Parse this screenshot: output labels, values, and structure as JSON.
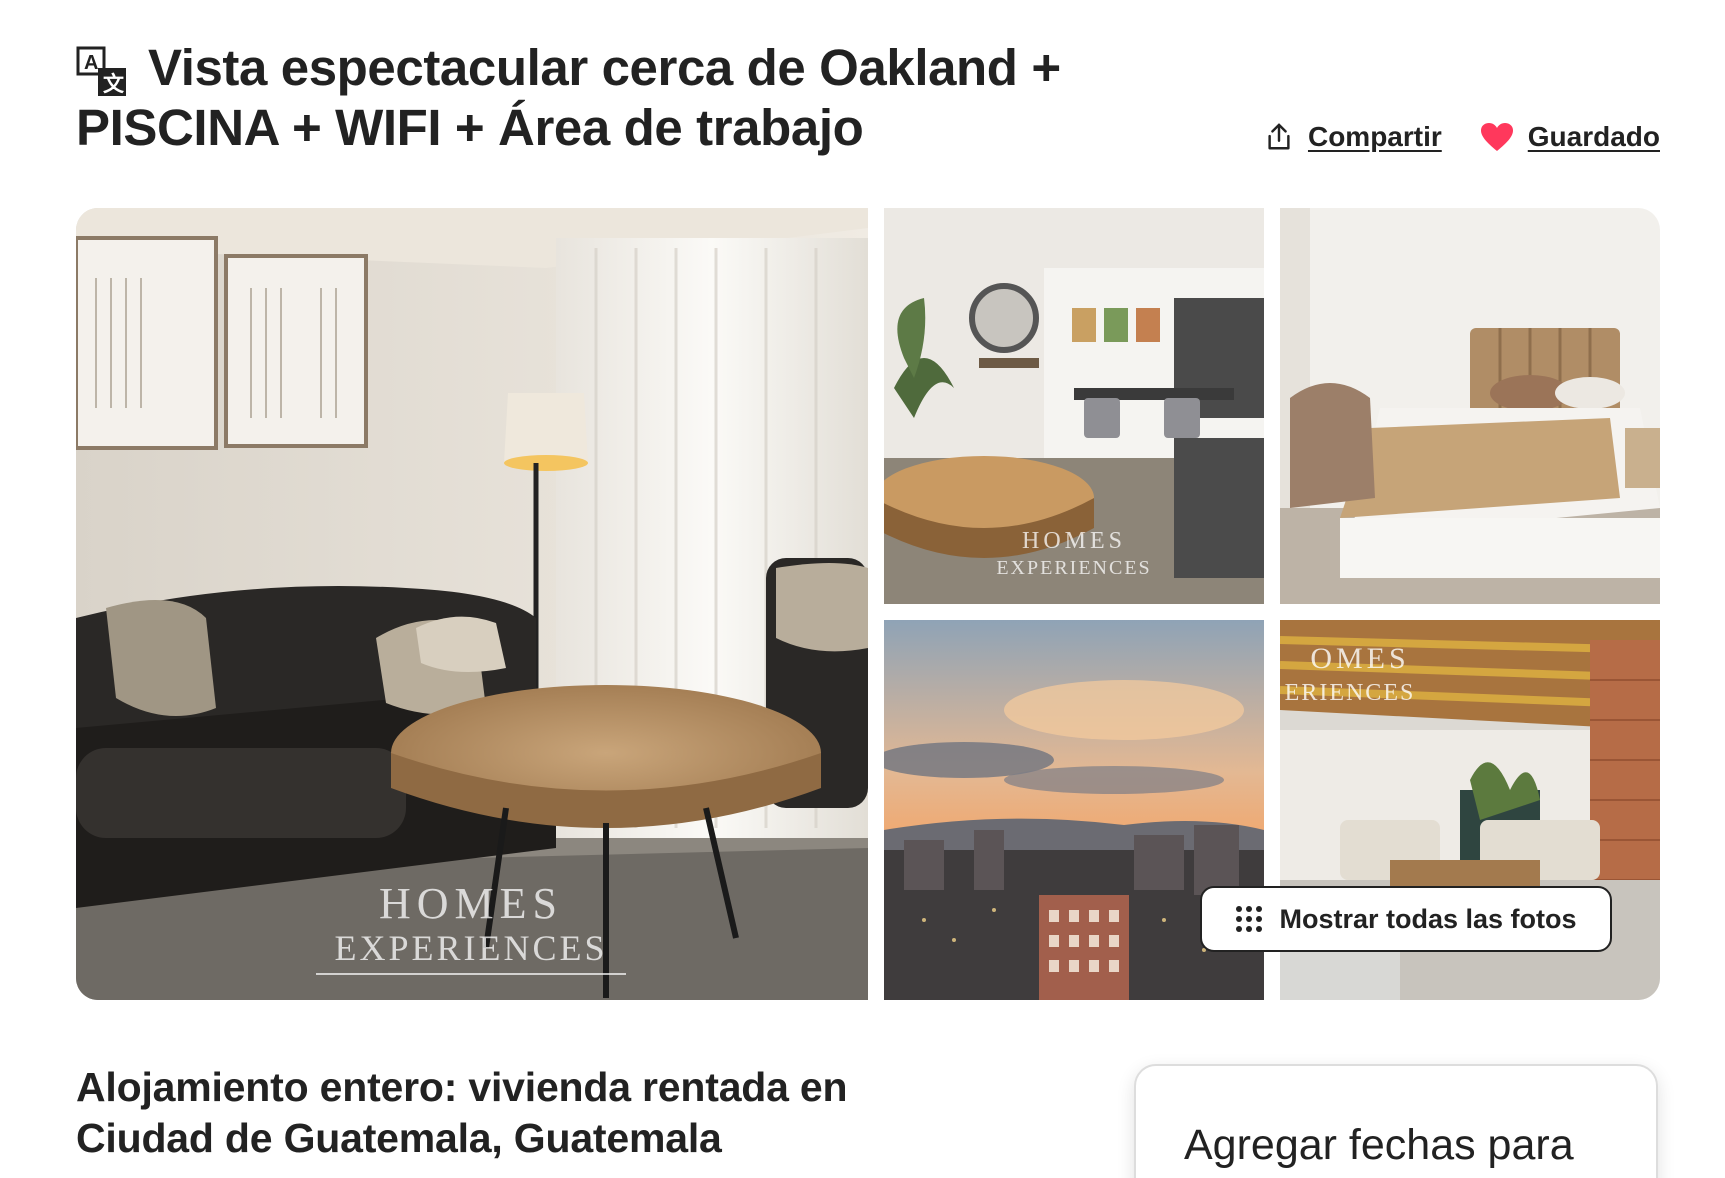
{
  "header": {
    "title": "Vista espectacular cerca de Oakland + PISCINA + WIFI + Área de trabajo",
    "translate_icon": "translate-icon",
    "share": {
      "label": "Compartir",
      "icon": "share-icon"
    },
    "save": {
      "label": "Guardado",
      "icon": "heart-icon",
      "saved": true
    }
  },
  "gallery": {
    "photos": [
      {
        "name": "living-room",
        "watermark_top": "HOMES",
        "watermark_bottom": "EXPERIENCES"
      },
      {
        "name": "dining-area",
        "watermark_top": "HOMES",
        "watermark_bottom": "EXPERIENCES"
      },
      {
        "name": "bedroom"
      },
      {
        "name": "city-sunset"
      },
      {
        "name": "lobby",
        "watermark_top": "OMES",
        "watermark_bottom": "ERIENCES"
      }
    ],
    "show_all_label": "Mostrar todas las fotos",
    "show_all_icon": "grid-dots-icon"
  },
  "listing": {
    "subtitle": "Alojamiento entero: vivienda rentada en Ciudad de Guatemala, Guatemala"
  },
  "booking": {
    "prompt": "Agregar fechas para los precios"
  },
  "colors": {
    "text": "#222222",
    "heart": "#FF385C",
    "border": "#DDDDDD",
    "background": "#FFFFFF"
  }
}
